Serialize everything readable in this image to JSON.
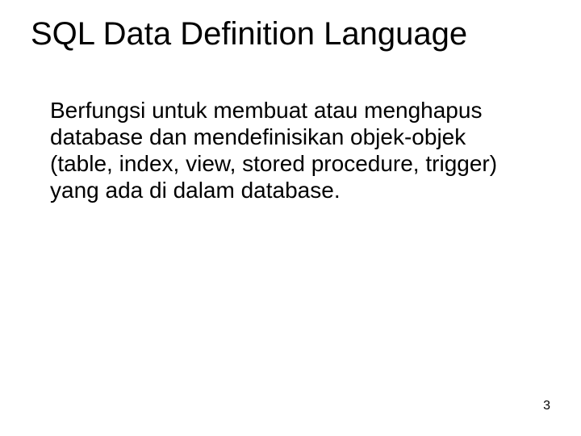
{
  "slide": {
    "title": "SQL Data Definition Language",
    "body": "Berfungsi untuk membuat atau menghapus database dan mendefinisikan objek-objek (table, index, view, stored procedure, trigger) yang ada di dalam database.",
    "page_number": "3"
  }
}
